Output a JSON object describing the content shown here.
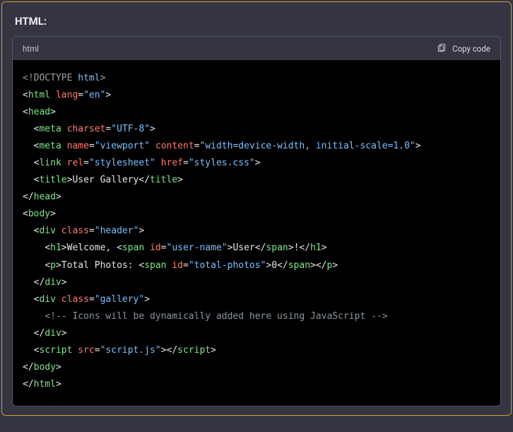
{
  "panel_title": "HTML:",
  "code_language": "html",
  "copy_label": "Copy code",
  "tokens": {
    "doctype_lt": "<!",
    "doctype_word": "DOCTYPE",
    "doctype_html": "html",
    "gt": ">",
    "lt": "<",
    "lt_close": "</",
    "tag_html": "html",
    "attr_lang": "lang",
    "eq": "=",
    "str_en": "\"en\"",
    "tag_head": "head",
    "tag_meta": "meta",
    "attr_charset": "charset",
    "str_utf8": "\"UTF-8\"",
    "attr_name": "name",
    "str_viewport": "\"viewport\"",
    "attr_content": "content",
    "str_viewport_val": "\"width=device-width, initial-scale=1.0\"",
    "tag_link": "link",
    "attr_rel": "rel",
    "str_stylesheet": "\"stylesheet\"",
    "attr_href": "href",
    "str_styles": "\"styles.css\"",
    "tag_title": "title",
    "title_text": "User Gallery",
    "tag_body": "body",
    "tag_div": "div",
    "attr_class": "class",
    "str_header": "\"header\"",
    "tag_h1": "h1",
    "h1_text_a": "Welcome, ",
    "tag_span": "span",
    "attr_id": "id",
    "str_username": "\"user-name\"",
    "span_user_text": "User",
    "h1_text_b": "!",
    "tag_p": "p",
    "p_text_a": "Total Photos: ",
    "str_totalphotos": "\"total-photos\"",
    "span_total_text": "0",
    "str_gallery": "\"gallery\"",
    "comment_open": "<!--",
    "comment_body": " Icons will be dynamically added here using JavaScript ",
    "comment_close": "-->",
    "tag_script": "script",
    "attr_src": "src",
    "str_scriptjs": "\"script.js\""
  }
}
